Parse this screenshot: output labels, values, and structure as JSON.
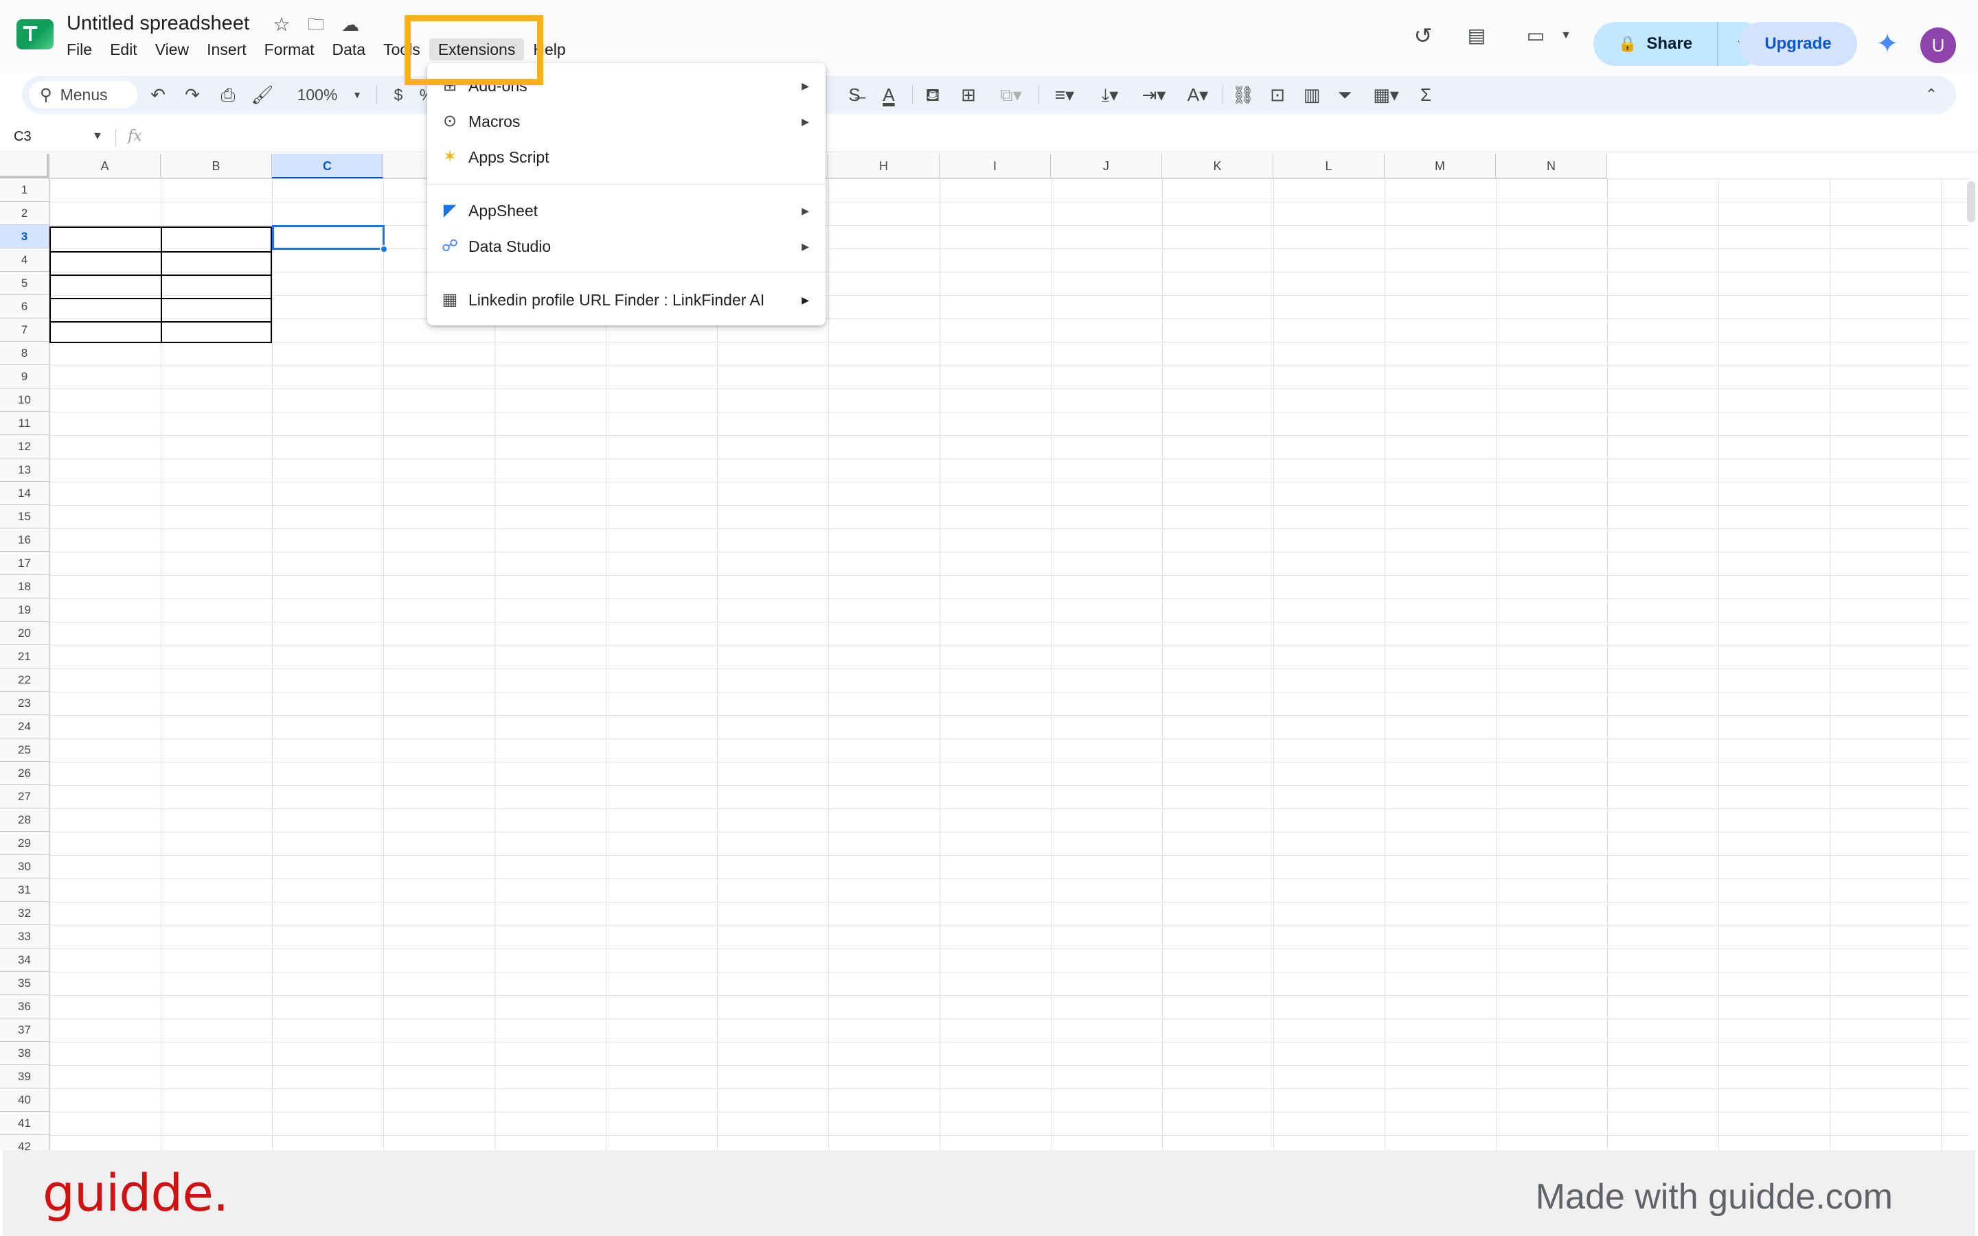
{
  "document": {
    "title": "Untitled spreadsheet"
  },
  "menubar": {
    "items": [
      "File",
      "Edit",
      "View",
      "Insert",
      "Format",
      "Data",
      "Tools",
      "Extensions",
      "Help"
    ],
    "active": "Extensions"
  },
  "header": {
    "share_label": "Share",
    "upgrade_label": "Upgrade",
    "avatar_initial": "U"
  },
  "toolbar": {
    "menus_label": "Menus",
    "zoom": "100%",
    "currency_label": "$",
    "percent_label": "%"
  },
  "formula_bar": {
    "name_box": "C3",
    "fx_label": "fx"
  },
  "grid": {
    "columns": [
      "A",
      "B",
      "C",
      "D",
      "E",
      "F",
      "G",
      "H",
      "I",
      "J",
      "K",
      "L",
      "M",
      "N"
    ],
    "selected_column": "C",
    "selected_row": "3",
    "rows": [
      "1",
      "2",
      "3",
      "4",
      "5",
      "6",
      "7",
      "8",
      "9",
      "10",
      "11",
      "12",
      "13",
      "14",
      "15",
      "16",
      "17",
      "18",
      "19",
      "20",
      "21",
      "22",
      "23",
      "24",
      "25",
      "26",
      "27",
      "28",
      "29",
      "30",
      "31",
      "32",
      "33",
      "34",
      "35",
      "36",
      "37",
      "38",
      "39",
      "40",
      "41",
      "42"
    ]
  },
  "extensions_menu": {
    "items": [
      {
        "label": "Add-ons",
        "icon": "add-ons-icon",
        "submenu": true
      },
      {
        "label": "Macros",
        "icon": "macros-icon",
        "submenu": true
      },
      {
        "label": "Apps Script",
        "icon": "apps-script-icon",
        "submenu": false
      },
      {
        "label": "AppSheet",
        "icon": "appsheet-icon",
        "submenu": true
      },
      {
        "label": "Data Studio",
        "icon": "data-studio-icon",
        "submenu": true
      },
      {
        "label": "Linkedin profile URL Finder : LinkFinder AI",
        "icon": "linkfinder-icon",
        "submenu": true
      }
    ]
  },
  "footer": {
    "logo": "guidde.",
    "text": "Made with guidde.com"
  },
  "colors": {
    "accent": "#1a73e8",
    "highlight": "#fbb01a",
    "share_bg": "#c2e7ff",
    "upgrade_bg": "#d3e3fd",
    "brand_red": "#d01212"
  }
}
